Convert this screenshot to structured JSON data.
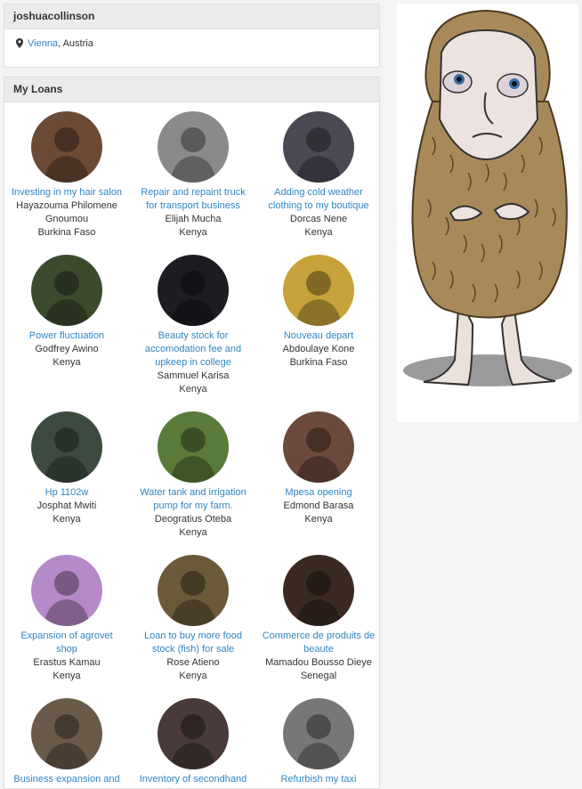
{
  "profile": {
    "username": "joshuacollinson",
    "city": "Vienna",
    "country_sep": ",",
    "country": "Austria"
  },
  "loans_panel": {
    "title": "My Loans",
    "items": [
      {
        "title": "Investing in my hair salon",
        "name": "Hayazouma Philomene Gnoumou",
        "country": "Burkina Faso",
        "color": "#6b4a36"
      },
      {
        "title": "Repair and repaint truck for transport business",
        "name": "Elijah Mucha",
        "country": "Kenya",
        "color": "#8a8a8a"
      },
      {
        "title": "Adding cold weather clothing to my boutique",
        "name": "Dorcas Nene",
        "country": "Kenya",
        "color": "#4a4a55"
      },
      {
        "title": "Power fluctuation",
        "name": "Godfrey Awino",
        "country": "Kenya",
        "color": "#3c4a2e"
      },
      {
        "title": "Beauty stock for accomodation fee and upkeep in college",
        "name": "Sammuel Karisa",
        "country": "Kenya",
        "color": "#1c1c22"
      },
      {
        "title": "Nouveau depart",
        "name": "Abdoulaye Kone",
        "country": "Burkina Faso",
        "color": "#c7a23a"
      },
      {
        "title": "Hp 1102w",
        "name": "Josphat Mwiti",
        "country": "Kenya",
        "color": "#3d4a3f"
      },
      {
        "title": "Water tank and irrigation pump for my farm.",
        "name": "Deogratius Oteba",
        "country": "Kenya",
        "color": "#5a7a3a"
      },
      {
        "title": "Mpesa opening",
        "name": "Edmond Barasa",
        "country": "Kenya",
        "color": "#6a4a3a"
      },
      {
        "title": "Expansion of agrovet shop",
        "name": "Erastus Kamau",
        "country": "Kenya",
        "color": "#b58ac8"
      },
      {
        "title": "Loan to buy more food stock (fish) for sale",
        "name": "Rose Atieno",
        "country": "Kenya",
        "color": "#6b5a3a"
      },
      {
        "title": "Commerce de produits de beaute",
        "name": "Mamadou Bousso Dieye",
        "country": "Senegal",
        "color": "#3a2a22"
      },
      {
        "title": "Business expansion and",
        "name": "",
        "country": "",
        "color": "#6a5a4a"
      },
      {
        "title": "Inventory of secondhand",
        "name": "",
        "country": "",
        "color": "#4a3a3a"
      },
      {
        "title": "Refurbish my taxi",
        "name": "",
        "country": "",
        "color": "#777777"
      }
    ]
  },
  "icons": {
    "location": "map-pin-icon"
  },
  "colors": {
    "link": "#2e86c1",
    "panel_header": "#ebebeb"
  }
}
